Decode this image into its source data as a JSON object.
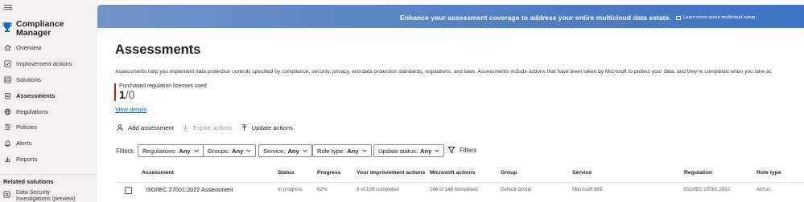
{
  "sidebar": {
    "title": "Compliance Manager",
    "items": [
      {
        "label": "Overview",
        "icon": "home-icon"
      },
      {
        "label": "Improvement actions",
        "icon": "checklist-icon"
      },
      {
        "label": "Solutions",
        "icon": "grid-icon"
      },
      {
        "label": "Assessments",
        "icon": "clipboard-icon",
        "active": true
      },
      {
        "label": "Regulations",
        "icon": "globe-icon"
      },
      {
        "label": "Policies",
        "icon": "policy-icon"
      },
      {
        "label": "Alerts",
        "icon": "bell-icon"
      },
      {
        "label": "Reports",
        "icon": "chart-icon"
      }
    ],
    "related_heading": "Related solutions",
    "related_item": "Data Security Investigations (preview)"
  },
  "banner": {
    "text": "Enhance your assessment coverage to address your entire multicloud data estate.",
    "link": "Learn more about multicloud setup"
  },
  "page": {
    "title": "Assessments",
    "description": "Assessments help you implement data protection controls specified by compliance, security, privacy, and data protection standards, regulations, and laws. Assessments include actions that have been taken by Microsoft to protect your data, and they're completed when you take ac",
    "licenses_label": "Purchased regulation licenses used",
    "licenses_used": "1",
    "licenses_total": "/0",
    "view_details": "View details"
  },
  "commands": {
    "add": "Add assessment",
    "export": "Export actions",
    "update": "Update actions"
  },
  "filters": {
    "label": "Filters:",
    "chips": [
      {
        "name": "Regulations:",
        "value": "Any"
      },
      {
        "name": "Groups:",
        "value": "Any"
      },
      {
        "name": "Service:",
        "value": "Any"
      },
      {
        "name": "Role type:",
        "value": "Any"
      },
      {
        "name": "Update status:",
        "value": "Any"
      }
    ],
    "button": "Filters"
  },
  "table": {
    "columns": [
      "Assessment",
      "Status",
      "Progress",
      "Your improvement actions",
      "Microsoft actions",
      "Group",
      "Service",
      "Regulation",
      "Role type"
    ],
    "rows": [
      [
        "ISO/IEC 27001:2022 Assessment",
        "In progress",
        "62%",
        "9 of 109 completed",
        "146 of 148 completed",
        "Default Group",
        "Microsoft 365",
        "ISO/IEC 27001:2022",
        "Admin"
      ]
    ]
  },
  "colors": {
    "accent": "#0f6cbd",
    "banner": "#4f7fc4",
    "license_bar": "#a4262c"
  }
}
